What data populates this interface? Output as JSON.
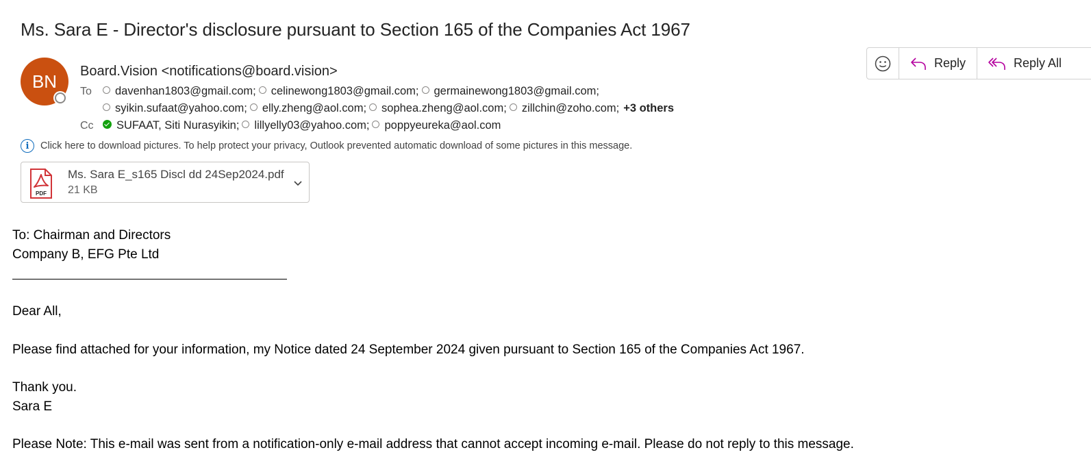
{
  "subject": "Ms. Sara E - Director's disclosure pursuant to Section 165 of the Companies Act 1967",
  "sender": {
    "initials": "BN",
    "display": "Board.Vision <notifications@board.vision>",
    "avatar_color": "#ca5010"
  },
  "to_label": "To",
  "cc_label": "Cc",
  "to_line1": [
    "davenhan1803@gmail.com;",
    "celinewong1803@gmail.com;",
    "germainewong1803@gmail.com;"
  ],
  "to_line2": [
    "syikin.sufaat@yahoo.com;",
    "elly.zheng@aol.com;",
    "sophea.zheng@aol.com;",
    "zillchin@zoho.com;"
  ],
  "to_more": "+3 others",
  "cc": [
    "SUFAAT, Siti Nurasyikin;",
    "lillyelly03@yahoo.com;",
    "poppyeureka@aol.com"
  ],
  "info_bar": "Click here to download pictures. To help protect your privacy, Outlook prevented automatic download of some pictures in this message.",
  "attachment": {
    "name": "Ms. Sara E_s165 Discl dd 24Sep2024.pdf",
    "size": "21 KB",
    "icon_label": "PDF"
  },
  "actions": {
    "reply": "Reply",
    "reply_all": "Reply All"
  },
  "body": {
    "to_line": "To: Chairman and Directors",
    "company": "Company B, EFG Pte Ltd",
    "greeting": "Dear All,",
    "paragraph": "Please find attached for your information, my Notice dated 24 September 2024 given pursuant to Section 165 of the Companies Act 1967.",
    "thanks": "Thank you.",
    "signature": "Sara E",
    "note": "Please Note: This e-mail was sent from a notification-only e-mail address that cannot accept incoming e-mail. Please do not reply to this message."
  },
  "icons": [
    "emoji-icon",
    "reply-icon",
    "reply-all-icon",
    "info-icon",
    "pdf-icon",
    "chevron-down-icon"
  ],
  "colors": {
    "accent": "#0f6cbd",
    "pdf_red": "#d13438",
    "presence_available": "#13a10e"
  }
}
